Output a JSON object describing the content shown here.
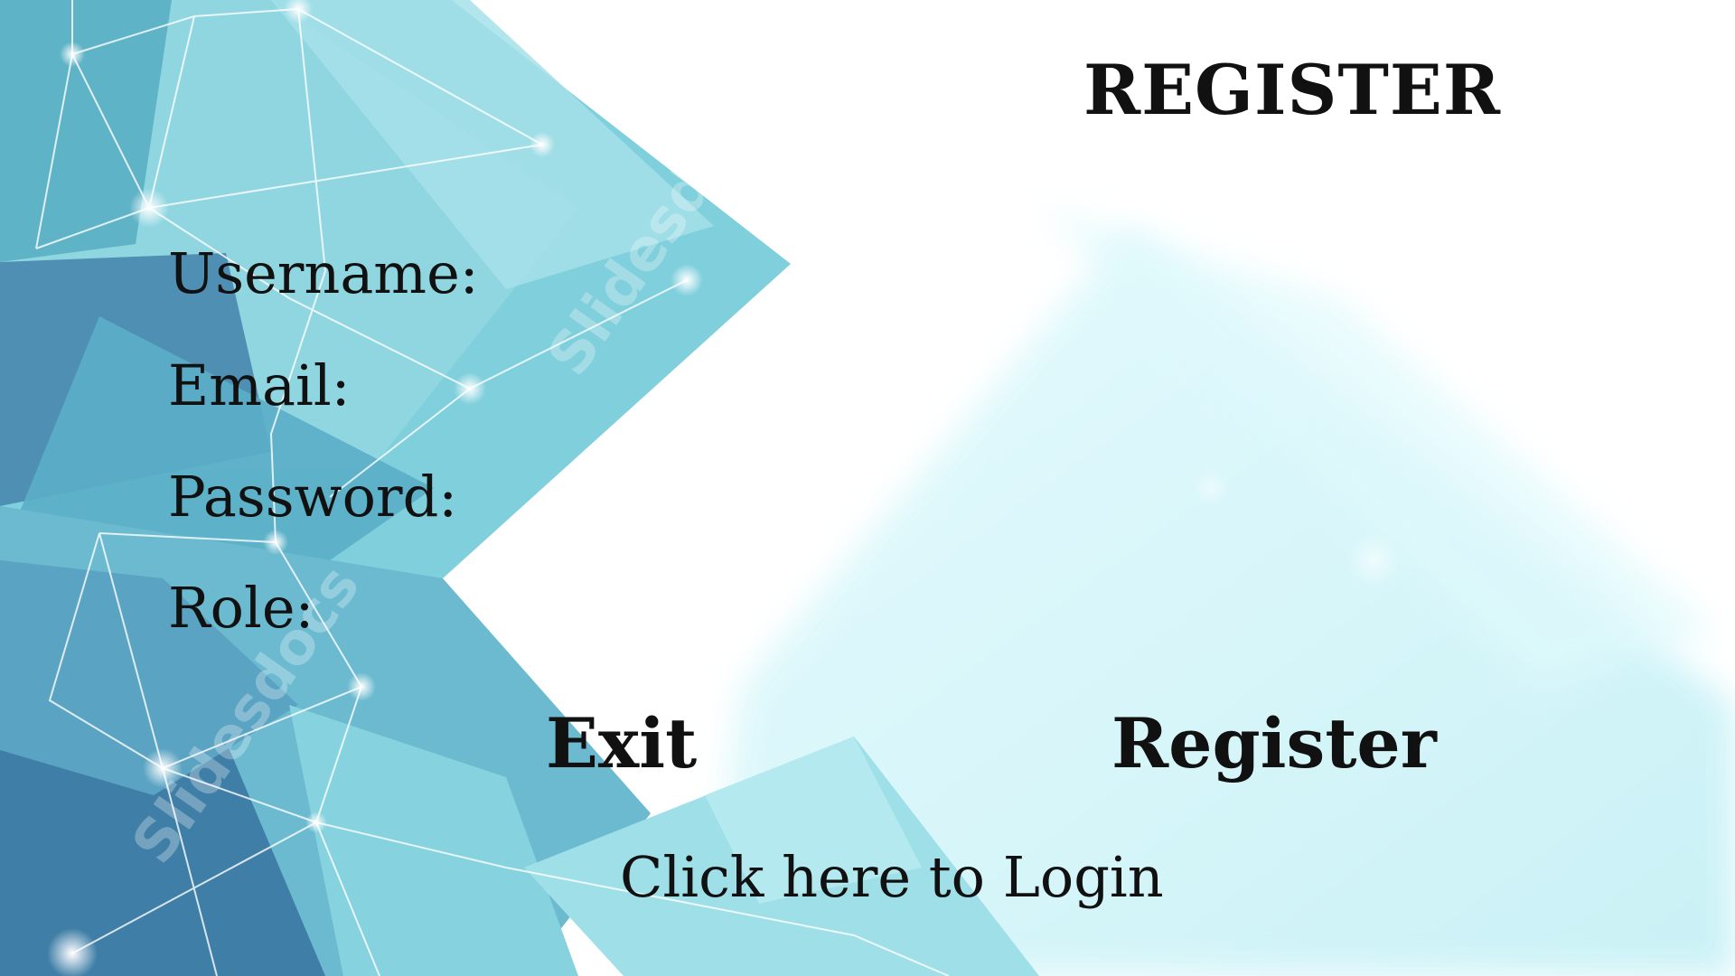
{
  "page": {
    "title": "REGISTER"
  },
  "form": {
    "username_label": "Username:",
    "username_value": "",
    "email_label": "Email:",
    "email_value": "",
    "password_label": "Password:",
    "password_value": "",
    "role_label": "Role:",
    "role_value": ""
  },
  "actions": {
    "exit_label": "Exit",
    "register_label": "Register",
    "login_link": "Click here to Login"
  },
  "background": {
    "watermark_text": "Slidesdocs",
    "colors": {
      "teal_dark": "#3f7ea6",
      "teal_mid": "#6bbfcf",
      "teal_light": "#9ad9e3",
      "cyan_wash": "#d9f8fb"
    }
  }
}
